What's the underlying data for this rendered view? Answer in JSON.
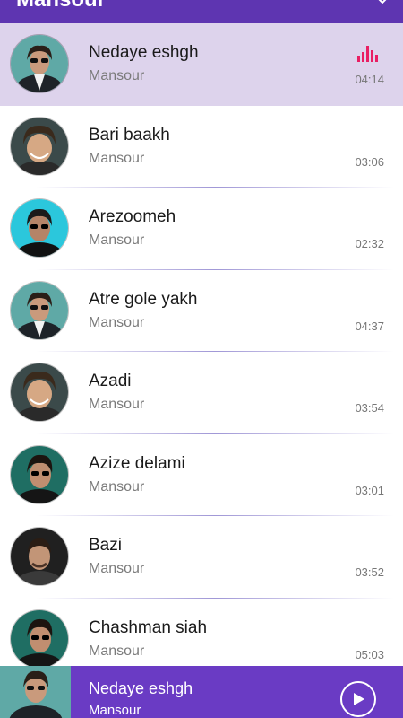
{
  "header": {
    "title": "Mansour"
  },
  "colors": {
    "accent": "#5e35b1",
    "active_row": "#ddd3ec",
    "equalizer": "#e91e63"
  },
  "songs": [
    {
      "title": "Nedaye eshgh",
      "artist": "Mansour",
      "duration": "04:14",
      "playing": true
    },
    {
      "title": "Bari baakh",
      "artist": "Mansour",
      "duration": "03:06"
    },
    {
      "title": "Arezoomeh",
      "artist": "Mansour",
      "duration": "02:32"
    },
    {
      "title": "Atre gole yakh",
      "artist": "Mansour",
      "duration": "04:37"
    },
    {
      "title": "Azadi",
      "artist": "Mansour",
      "duration": "03:54"
    },
    {
      "title": "Azize delami",
      "artist": "Mansour",
      "duration": "03:01"
    },
    {
      "title": "Bazi",
      "artist": "Mansour",
      "duration": "03:52"
    },
    {
      "title": "Chashman siah",
      "artist": "Mansour",
      "duration": "05:03"
    }
  ],
  "now_playing": {
    "title": "Nedaye eshgh",
    "artist": "Mansour",
    "icon": "play-icon"
  }
}
